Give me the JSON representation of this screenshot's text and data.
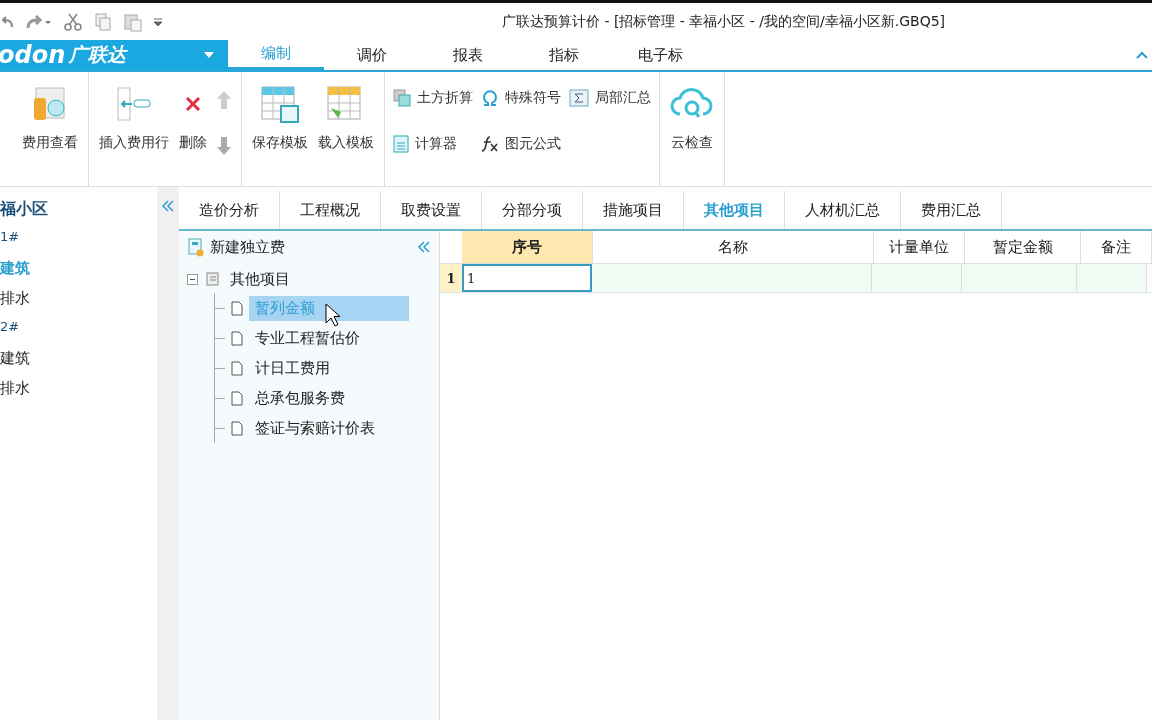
{
  "window": {
    "title": "广联达预算计价 - [招标管理 - 幸福小区 - /我的空间/幸福小区新.GBQ5]"
  },
  "logo": {
    "latin": "odon",
    "brand": "广联达"
  },
  "ribbon_tabs": [
    {
      "label": "编制",
      "selected": true
    },
    {
      "label": "调价",
      "selected": false
    },
    {
      "label": "报表",
      "selected": false
    },
    {
      "label": "指标",
      "selected": false
    },
    {
      "label": "电子标",
      "selected": false
    }
  ],
  "ribbon_groups": [
    {
      "buttons": [
        {
          "kind": "large",
          "label": "费用查看"
        }
      ]
    },
    {
      "buttons": [
        {
          "kind": "large",
          "label": "插入费用行"
        },
        {
          "kind": "large",
          "label": "删除"
        },
        {
          "kind": "arrows"
        }
      ]
    },
    {
      "buttons": [
        {
          "kind": "large",
          "label": "保存模板"
        },
        {
          "kind": "large",
          "label": "载入模板"
        }
      ]
    },
    {
      "buttons": [
        {
          "kind": "small",
          "label": "土方折算"
        },
        {
          "kind": "small",
          "label": "计算器"
        },
        {
          "kind": "small",
          "label": "特殊符号"
        },
        {
          "kind": "small",
          "label": "图元公式"
        },
        {
          "kind": "small",
          "label": "局部汇总"
        }
      ]
    },
    {
      "buttons": [
        {
          "kind": "large",
          "label": "云检查"
        }
      ]
    }
  ],
  "project_tree": [
    {
      "label": "福小区",
      "kind": "project",
      "selected": false
    },
    {
      "label": "1#",
      "kind": "building",
      "selected": false
    },
    {
      "label": "建筑",
      "kind": "unit",
      "selected": true
    },
    {
      "label": "排水",
      "kind": "unit",
      "selected": false
    },
    {
      "label": "2#",
      "kind": "building",
      "selected": false
    },
    {
      "label": "建筑",
      "kind": "unit",
      "selected": false
    },
    {
      "label": "排水",
      "kind": "unit",
      "selected": false
    }
  ],
  "doc_tabs": [
    {
      "label": "造价分析",
      "selected": false
    },
    {
      "label": "工程概况",
      "selected": false
    },
    {
      "label": "取费设置",
      "selected": false
    },
    {
      "label": "分部分项",
      "selected": false
    },
    {
      "label": "措施项目",
      "selected": false
    },
    {
      "label": "其他项目",
      "selected": true
    },
    {
      "label": "人材机汇总",
      "selected": false
    },
    {
      "label": "费用汇总",
      "selected": false
    }
  ],
  "side_panel": {
    "new_button": "新建独立费",
    "tree": [
      {
        "label": "其他项目",
        "expanded": true,
        "children": [
          {
            "label": "暂列金额",
            "selected": true
          },
          {
            "label": "专业工程暂估价",
            "selected": false
          },
          {
            "label": "计日工费用",
            "selected": false
          },
          {
            "label": "总承包服务费",
            "selected": false
          },
          {
            "label": "签证与索赔计价表",
            "selected": false
          }
        ]
      }
    ]
  },
  "table": {
    "columns": [
      {
        "label": "序号",
        "selected": true
      },
      {
        "label": "名称",
        "selected": false
      },
      {
        "label": "计量单位",
        "selected": false
      },
      {
        "label": "暂定金额",
        "selected": false
      },
      {
        "label": "备注",
        "selected": false
      }
    ],
    "rows": [
      {
        "number": "1",
        "cells": [
          {
            "text": "1",
            "selected": true
          },
          {
            "selected": false
          },
          {
            "selected": false
          },
          {
            "selected": false
          },
          {
            "selected": false
          }
        ]
      }
    ]
  }
}
